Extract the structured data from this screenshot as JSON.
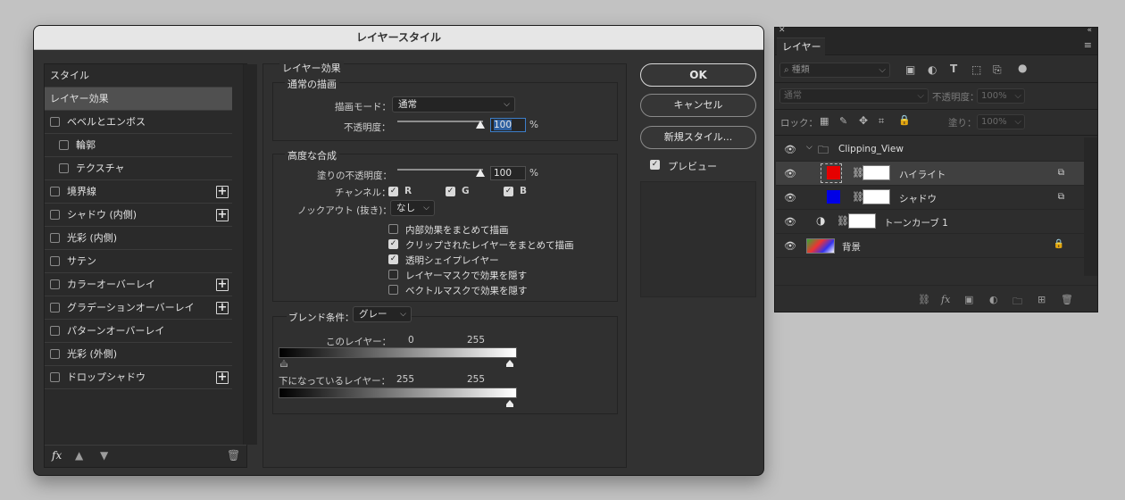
{
  "dialog": {
    "title": "レイヤースタイル",
    "styles": [
      {
        "label": "スタイル",
        "type": "header"
      },
      {
        "label": "レイヤー効果",
        "type": "header",
        "selected": true
      },
      {
        "label": "ベベルとエンボス",
        "type": "check"
      },
      {
        "label": "輪郭",
        "type": "sub"
      },
      {
        "label": "テクスチャ",
        "type": "sub"
      },
      {
        "label": "境界線",
        "type": "check",
        "plus": true
      },
      {
        "label": "シャドウ (内側)",
        "type": "check",
        "plus": true
      },
      {
        "label": "光彩 (内側)",
        "type": "check"
      },
      {
        "label": "サテン",
        "type": "check"
      },
      {
        "label": "カラーオーバーレイ",
        "type": "check",
        "plus": true
      },
      {
        "label": "グラデーションオーバーレイ",
        "type": "check",
        "plus": true
      },
      {
        "label": "パターンオーバーレイ",
        "type": "check"
      },
      {
        "label": "光彩 (外側)",
        "type": "check"
      },
      {
        "label": "ドロップシャドウ",
        "type": "check",
        "plus": true
      }
    ],
    "footer": {
      "fx": "fx",
      "up": "▲",
      "down": "▼",
      "trash": "🗑"
    },
    "panel_title": "レイヤー効果",
    "general": {
      "title": "通常の描画",
      "mode_label": "描画モード：",
      "mode_value": "通常",
      "opacity_label": "不透明度：",
      "opacity_value": "100",
      "percent": "%"
    },
    "advanced": {
      "title": "高度な合成",
      "fill_label": "塗りの不透明度：",
      "fill_value": "100",
      "percent": "%",
      "channels_label": "チャンネル：",
      "channels": [
        "R",
        "G",
        "B"
      ],
      "knockout_label": "ノックアウト (抜き)：",
      "knockout_value": "なし",
      "options": [
        {
          "label": "内部効果をまとめて描画",
          "checked": false
        },
        {
          "label": "クリップされたレイヤーをまとめて描画",
          "checked": true
        },
        {
          "label": "透明シェイプレイヤー",
          "checked": true
        },
        {
          "label": "レイヤーマスクで効果を隠す",
          "checked": false
        },
        {
          "label": "ベクトルマスクで効果を隠す",
          "checked": false
        }
      ]
    },
    "blend_if": {
      "label": "ブレンド条件：",
      "value": "グレー",
      "this_layer_label": "このレイヤー：",
      "this_layer_values": [
        "0",
        "255"
      ],
      "underlying_label": "下になっているレイヤー：",
      "underlying_values": [
        "255",
        "255"
      ]
    },
    "buttons": {
      "ok": "OK",
      "cancel": "キャンセル",
      "new_style": "新規スタイル...",
      "preview": "プレビュー"
    }
  },
  "layers_panel": {
    "tab": "レイヤー",
    "search_placeholder": "種類",
    "blend_mode": "通常",
    "opacity_label": "不透明度：",
    "opacity_value": "100%",
    "lock_label": "ロック：",
    "fill_label": "塗り：",
    "fill_value": "100%",
    "layers": [
      {
        "name": "Clipping_View",
        "kind": "group"
      },
      {
        "name": "ハイライト",
        "kind": "layer",
        "swatch": "#e60000",
        "selected": true
      },
      {
        "name": "シャドウ",
        "kind": "layer",
        "swatch": "#0000e6"
      },
      {
        "name": "トーンカーブ 1",
        "kind": "adjustment"
      },
      {
        "name": "背景",
        "kind": "background"
      }
    ]
  },
  "colors": {
    "accent_focus": "#3c7ec9",
    "highlight_swatch": "#e60000",
    "shadow_swatch": "#0000e6"
  }
}
